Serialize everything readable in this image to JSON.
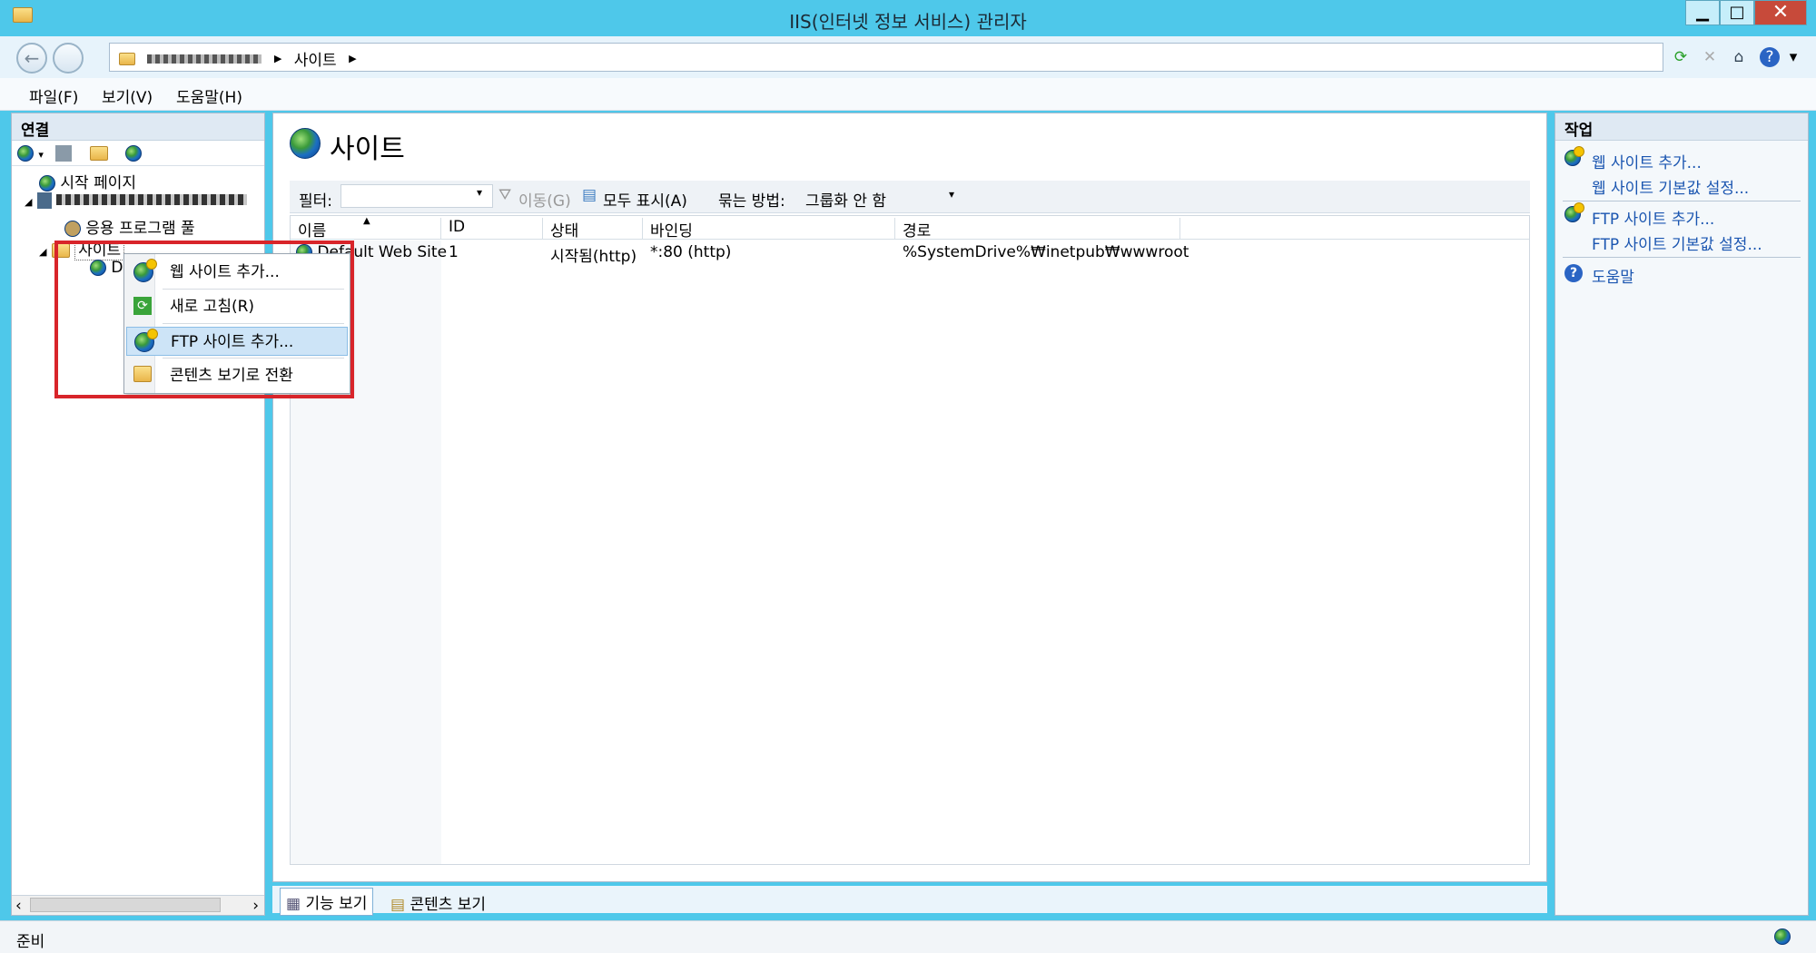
{
  "window": {
    "title": "IIS(인터넷 정보 서비스) 관리자",
    "minimize": "▁",
    "maximize": "□",
    "close": "✕"
  },
  "address": {
    "crumbs": [
      "▶ ▶",
      "사이트"
    ],
    "separator": "▸"
  },
  "menu": {
    "items": [
      "파일(F)",
      "보기(V)",
      "도움말(H)"
    ]
  },
  "connections": {
    "title": "연결",
    "tree": {
      "start_page": "시작 페이지",
      "server": "",
      "app_pool": "응용 프로그램 풀",
      "sites": "사이트",
      "site_child": "D"
    }
  },
  "main": {
    "heading": "사이트",
    "filter": {
      "label": "필터:",
      "go": "이동(G)",
      "show_all": "모두 표시(A)",
      "group_label": "묶는 방법:",
      "group_value": "그룹화 안 함"
    },
    "columns": [
      "이름",
      "ID",
      "상태",
      "바인딩",
      "경로"
    ],
    "rows": [
      {
        "name": "Default Web Site",
        "id": "1",
        "status": "시작됨(http)",
        "binding": "*:80 (http)",
        "path": "%SystemDrive%₩inetpub₩wwwroot"
      }
    ],
    "tabs": {
      "features": "기능 보기",
      "content": "콘텐츠 보기"
    }
  },
  "context_menu": {
    "items": [
      "웹 사이트 추가...",
      "새로 고침(R)",
      "FTP 사이트 추가...",
      "콘텐츠 보기로 전환"
    ]
  },
  "actions": {
    "title": "작업",
    "add_web_site": "웹 사이트 추가...",
    "web_defaults": "웹 사이트 기본값 설정...",
    "add_ftp_site": "FTP 사이트 추가...",
    "ftp_defaults": "FTP 사이트 기본값 설정...",
    "help": "도움말"
  },
  "status": {
    "text": "준비"
  },
  "colors": {
    "titlebar": "#4ec8ea",
    "link": "#1a55b0",
    "highlight_box": "#d8252a",
    "menu_selected": "#cde4f7"
  }
}
